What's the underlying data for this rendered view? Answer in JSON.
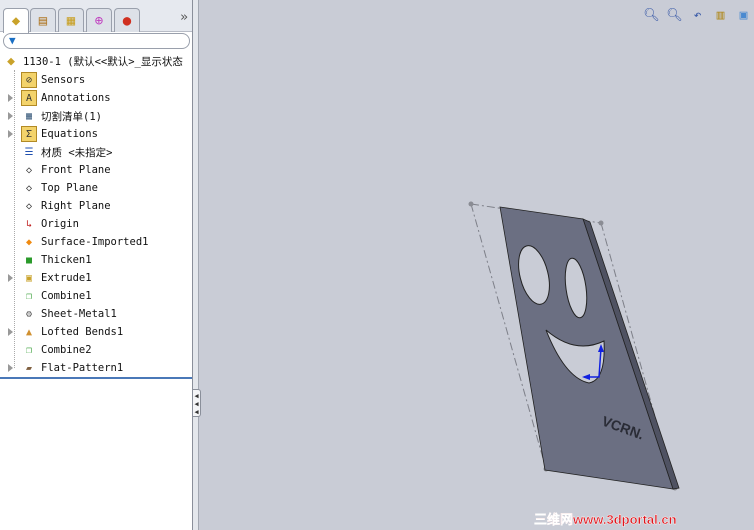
{
  "tabs": [
    {
      "name": "featuremanager",
      "icon": "parts-icon"
    },
    {
      "name": "propertymanager",
      "icon": "property-icon"
    },
    {
      "name": "configurationmanager",
      "icon": "configuration-icon"
    },
    {
      "name": "dimxpert",
      "icon": "target-icon"
    },
    {
      "name": "display-manager",
      "icon": "appearance-icon"
    }
  ],
  "more_label": "»",
  "filter_icon": "filter-icon",
  "tree": {
    "root": "1130-1  (默认<<默认>_显示状态",
    "items": [
      {
        "label": "Sensors",
        "icon": "sensors-icon",
        "expandable": false
      },
      {
        "label": "Annotations",
        "icon": "annotations-icon",
        "expandable": true
      },
      {
        "label": "切割清单(1)",
        "icon": "cut-list-icon",
        "expandable": true
      },
      {
        "label": "Equations",
        "icon": "equations-icon",
        "expandable": true
      },
      {
        "label": "材质 <未指定>",
        "icon": "material-icon",
        "expandable": false
      },
      {
        "label": "Front Plane",
        "icon": "plane-icon",
        "expandable": false
      },
      {
        "label": "Top Plane",
        "icon": "plane-icon",
        "expandable": false
      },
      {
        "label": "Right Plane",
        "icon": "plane-icon",
        "expandable": false
      },
      {
        "label": "Origin",
        "icon": "origin-icon",
        "expandable": false
      },
      {
        "label": "Surface-Imported1",
        "icon": "surface-icon",
        "expandable": false
      },
      {
        "label": "Thicken1",
        "icon": "thicken-icon",
        "expandable": false
      },
      {
        "label": "Extrude1",
        "icon": "extrude-icon",
        "expandable": true
      },
      {
        "label": "Combine1",
        "icon": "combine-icon",
        "expandable": false
      },
      {
        "label": "Sheet-Metal1",
        "icon": "sheet-metal-icon",
        "expandable": false
      },
      {
        "label": "Lofted Bends1",
        "icon": "lofted-bends-icon",
        "expandable": true
      },
      {
        "label": "Combine2",
        "icon": "combine-icon",
        "expandable": false
      },
      {
        "label": "Flat-Pattern1",
        "icon": "flat-pattern-icon",
        "expandable": true
      }
    ]
  },
  "view_tools": [
    "zoom-to-fit-icon",
    "zoom-to-area-icon",
    "previous-view-icon",
    "section-view-icon",
    "view-orientation-icon"
  ],
  "watermark": "三维网www.3dportal.cn",
  "colors": {
    "viewport_bg": "#c9ccd6",
    "plate": "#6b6f82",
    "tree_separator": "#4a78b8"
  }
}
